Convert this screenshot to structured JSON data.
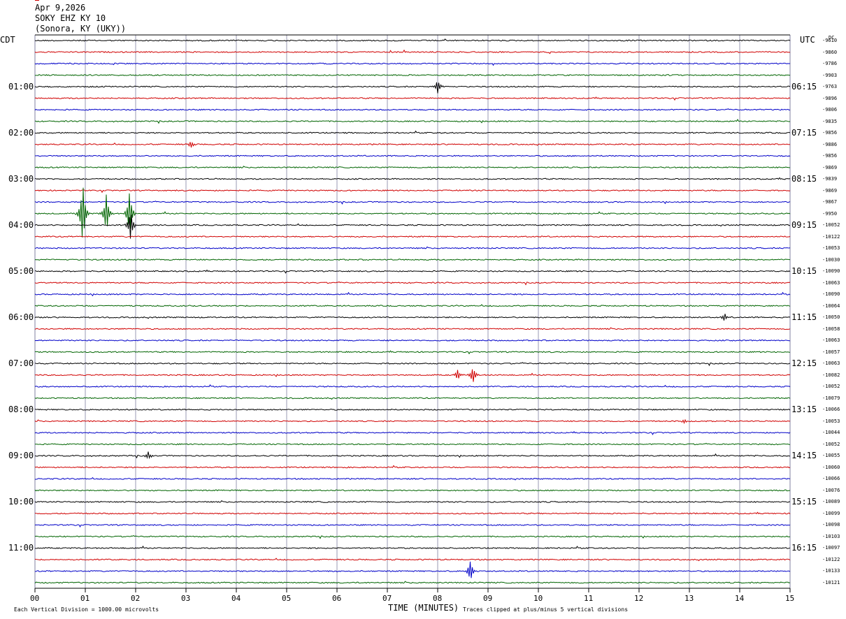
{
  "header": {
    "date": "Apr 9,2026",
    "station": "SOKY EHZ KY 10",
    "location": "(Sonora, KY (UKY))"
  },
  "left_tz": "CDT",
  "right_tz": "UTC",
  "dc_header": "DC",
  "left_time_labels": [
    "01:00",
    "02:00",
    "03:00",
    "04:00",
    "05:00",
    "06:00",
    "07:00",
    "08:00",
    "09:00",
    "10:00",
    "11:00"
  ],
  "right_time_labels": [
    "06:15",
    "07:15",
    "08:15",
    "09:15",
    "10:15",
    "11:15",
    "12:15",
    "13:15",
    "14:15",
    "15:15",
    "16:15"
  ],
  "dc_offsets": [
    "-9610",
    "-9860",
    "-9786",
    "-9903",
    "-9763",
    "-9896",
    "-9806",
    "-9835",
    "-9856",
    "-9886",
    "-9856",
    "-9869",
    "-9839",
    "-9869",
    "-9867",
    "-9950",
    "-10052",
    "-10122",
    "-10053",
    "-10030",
    "-10090",
    "-10063",
    "-10090",
    "-10064",
    "-10050",
    "-10058",
    "-10063",
    "-10057",
    "-10063",
    "-10082",
    "-10052",
    "-10079",
    "-10066",
    "-10053",
    "-10044",
    "-10052",
    "-10055",
    "-10060",
    "-10066",
    "-10076",
    "-10089",
    "-10099",
    "-10098",
    "-10103",
    "-10097",
    "-10122",
    "-10133",
    "-10121"
  ],
  "footer": {
    "x_axis_title": "TIME (MINUTES)",
    "scale_note": "Each Vertical Division = 1000.00 microvolts",
    "clip_note": "Traces clipped at plus/minus 5 vertical divisions"
  },
  "colors": {
    "trace_cycle": [
      "#000000",
      "#d00000",
      "#0000c8",
      "#006400"
    ],
    "grid": "#8080a0",
    "background": "#ffffff"
  },
  "chart_data": {
    "type": "line",
    "xlabel": "TIME (MINUTES)",
    "x_ticks": [
      "00",
      "01",
      "02",
      "03",
      "04",
      "05",
      "06",
      "07",
      "08",
      "09",
      "10",
      "11",
      "12",
      "13",
      "14",
      "15"
    ],
    "xlim": [
      0,
      15
    ],
    "traces_count": 48,
    "minutes_per_trace": 15,
    "grid": true,
    "events": [
      {
        "trace": 15,
        "minute": 0.95,
        "amplitude": 2.4
      },
      {
        "trace": 15,
        "minute": 1.42,
        "amplitude": 1.6
      },
      {
        "trace": 15,
        "minute": 1.88,
        "amplitude": 1.9
      },
      {
        "trace": 16,
        "minute": 1.9,
        "amplitude": 1.3
      },
      {
        "trace": 29,
        "minute": 8.7,
        "amplitude": 0.6
      },
      {
        "trace": 29,
        "minute": 8.4,
        "amplitude": 0.4
      },
      {
        "trace": 33,
        "minute": 12.9,
        "amplitude": 0.45
      },
      {
        "trace": 46,
        "minute": 8.65,
        "amplitude": 0.8
      },
      {
        "trace": 24,
        "minute": 13.7,
        "amplitude": 0.5
      },
      {
        "trace": 4,
        "minute": 8.0,
        "amplitude": 0.5
      },
      {
        "trace": 9,
        "minute": 3.1,
        "amplitude": 0.5
      },
      {
        "trace": 36,
        "minute": 2.25,
        "amplitude": 0.4
      }
    ]
  }
}
